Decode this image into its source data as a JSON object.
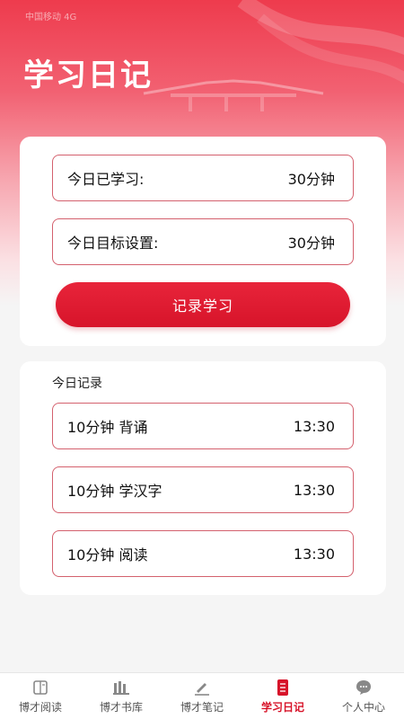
{
  "status_bar": {
    "text": "中国移动 4G"
  },
  "header": {
    "title": "学习日记"
  },
  "summary": {
    "studied_label": "今日已学习:",
    "studied_value": "30分钟",
    "goal_label": "今日目标设置:",
    "goal_value": "30分钟",
    "record_button": "记录学习"
  },
  "today": {
    "title": "今日记录",
    "records": [
      {
        "desc": "10分钟 背诵",
        "time": "13:30"
      },
      {
        "desc": "10分钟 学汉字",
        "time": "13:30"
      },
      {
        "desc": "10分钟 阅读",
        "time": "13:30"
      }
    ]
  },
  "tabs": [
    {
      "label": "博才阅读",
      "icon": "book-icon"
    },
    {
      "label": "博才书库",
      "icon": "library-icon"
    },
    {
      "label": "博才笔记",
      "icon": "pen-icon"
    },
    {
      "label": "学习日记",
      "icon": "notebook-icon",
      "active": true
    },
    {
      "label": "个人中心",
      "icon": "chat-bubble-icon"
    }
  ],
  "colors": {
    "accent": "#d7142a",
    "border": "#d4616e"
  }
}
